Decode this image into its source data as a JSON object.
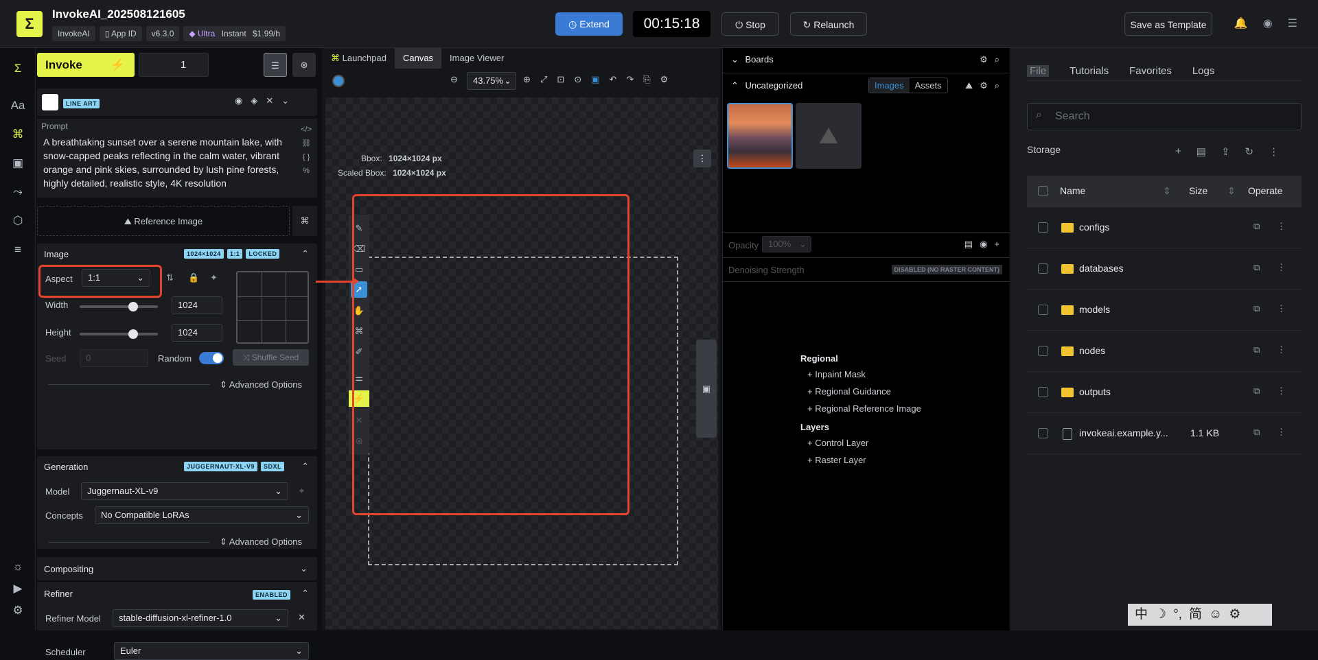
{
  "app": {
    "title": "InvokeAI_202508121605",
    "logo": "Σ",
    "tags": [
      "InvokeAI",
      "App ID",
      "v6.3.0",
      "Ultra",
      "Instant",
      "$1.99/h"
    ]
  },
  "header": {
    "extend": "Extend",
    "timer": "00:15:18",
    "stop": "Stop",
    "relaunch": "Relaunch",
    "save_template": "Save as Template"
  },
  "left": {
    "invoke": "Invoke",
    "qty": "1",
    "lineart": "LINE ART",
    "prompt_label": "Prompt",
    "prompt": "A breathtaking sunset over a serene mountain lake, with snow-capped peaks reflecting in the calm water, vibrant orange and pink skies, surrounded by lush pine forests, highly detailed, realistic style, 4K resolution",
    "ref_image": "Reference Image",
    "image": {
      "title": "Image",
      "badges": [
        "1024×1024",
        "1:1",
        "LOCKED"
      ],
      "aspect_label": "Aspect",
      "aspect": "1:1",
      "width_label": "Width",
      "width": "1024",
      "height_label": "Height",
      "height": "1024",
      "seed_label": "Seed",
      "seed": "0",
      "random": "Random",
      "shuffle": "Shuffle Seed",
      "advanced": "Advanced Options"
    },
    "generation": {
      "title": "Generation",
      "badges": [
        "JUGGERNAUT-XL-V9",
        "SDXL"
      ],
      "model_label": "Model",
      "model": "Juggernaut-XL-v9",
      "concepts_label": "Concepts",
      "concepts": "No Compatible LoRAs",
      "advanced": "Advanced Options"
    },
    "compositing": "Compositing",
    "refiner": {
      "title": "Refiner",
      "badge": "ENABLED",
      "model_label": "Refiner Model",
      "model": "stable-diffusion-xl-refiner-1.0",
      "scheduler_label": "Scheduler",
      "scheduler": "Euler"
    }
  },
  "center": {
    "tabs": [
      "Launchpad",
      "Canvas",
      "Image Viewer"
    ],
    "zoom": "43.75%",
    "bbox_label": "Bbox:",
    "bbox": "1024×1024 px",
    "scaled_label": "Scaled Bbox:",
    "scaled": "1024×1024 px"
  },
  "boards": {
    "title": "Boards",
    "uncategorized": "Uncategorized",
    "tab_images": "Images",
    "tab_assets": "Assets",
    "opacity_label": "Opacity",
    "opacity": "100%",
    "denoise": "Denoising Strength",
    "denoise_badge": "DISABLED (NO RASTER CONTENT)",
    "regional": "Regional",
    "regional_items": [
      "Inpaint Mask",
      "Regional Guidance",
      "Regional Reference Image"
    ],
    "layers": "Layers",
    "layer_items": [
      "Control Layer",
      "Raster Layer"
    ]
  },
  "right": {
    "tabs": [
      "File",
      "Tutorials",
      "Favorites",
      "Logs"
    ],
    "search": "Search",
    "storage": "Storage",
    "cols": [
      "Name",
      "Size",
      "Operate"
    ],
    "rows": [
      {
        "name": "configs",
        "size": ""
      },
      {
        "name": "databases",
        "size": ""
      },
      {
        "name": "models",
        "size": ""
      },
      {
        "name": "nodes",
        "size": ""
      },
      {
        "name": "outputs",
        "size": ""
      },
      {
        "name": "invokeai.example.y...",
        "size": "1.1 KB"
      }
    ]
  },
  "bottom": [
    "中",
    "☽",
    "°,",
    "简",
    "☺",
    "⚙"
  ]
}
